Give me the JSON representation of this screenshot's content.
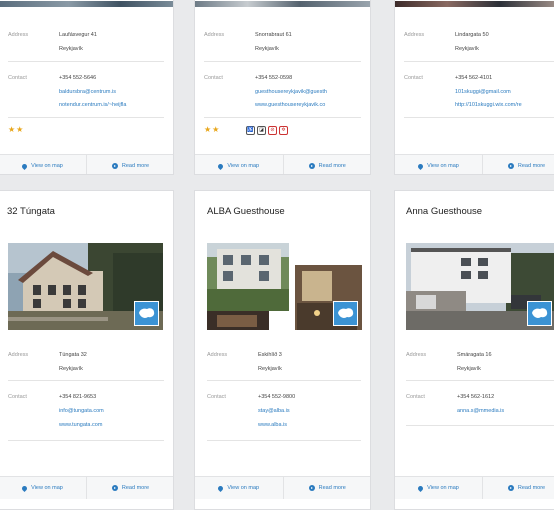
{
  "common": {
    "address_label": "Address",
    "contact_label": "Contact",
    "view_map": "View on map",
    "read_more": "Read more"
  },
  "cards_top": [
    {
      "address1": "Laufásvegur 41",
      "address2": "Reykjavík",
      "phone": "+354 552-5646",
      "email": "baldursbra@centrum.is",
      "web": "notendur.centrum.is/~heijfla",
      "stars": "★★"
    },
    {
      "address1": "Snorrabraut 61",
      "address2": "Reykjavík",
      "phone": "+354 552-0598",
      "email": "guesthousereykjavik@guesth",
      "web": "www.guesthousereykjavik.co",
      "stars": "★★",
      "amenities": [
        "♿",
        "◪",
        "⊘",
        "✲"
      ]
    },
    {
      "address1": "Lindargata 50",
      "address2": "Reykjavík",
      "phone": "+354 562-4101",
      "email": "101skuggi@gmail.com",
      "web": "http://101skuggi.wix.com/re"
    }
  ],
  "cards_bottom": [
    {
      "title": "32 Túngata",
      "address1": "Túngata 32",
      "address2": "Reykjavík",
      "phone": "+354 821-9653",
      "email": "info@tungata.com",
      "web": "www.tungata.com"
    },
    {
      "title": "ALBA Guesthouse",
      "address1": "Eskihlíð 3",
      "address2": "Reykjavík",
      "phone": "+354 552-9800",
      "email": "stay@alba.is",
      "web": "www.alba.is"
    },
    {
      "title": "Anna Guesthouse",
      "address1": "Smáragata 16",
      "address2": "Reykjavík",
      "phone": "+354 562-1612",
      "email": "anna.s@mmedia.is"
    }
  ]
}
